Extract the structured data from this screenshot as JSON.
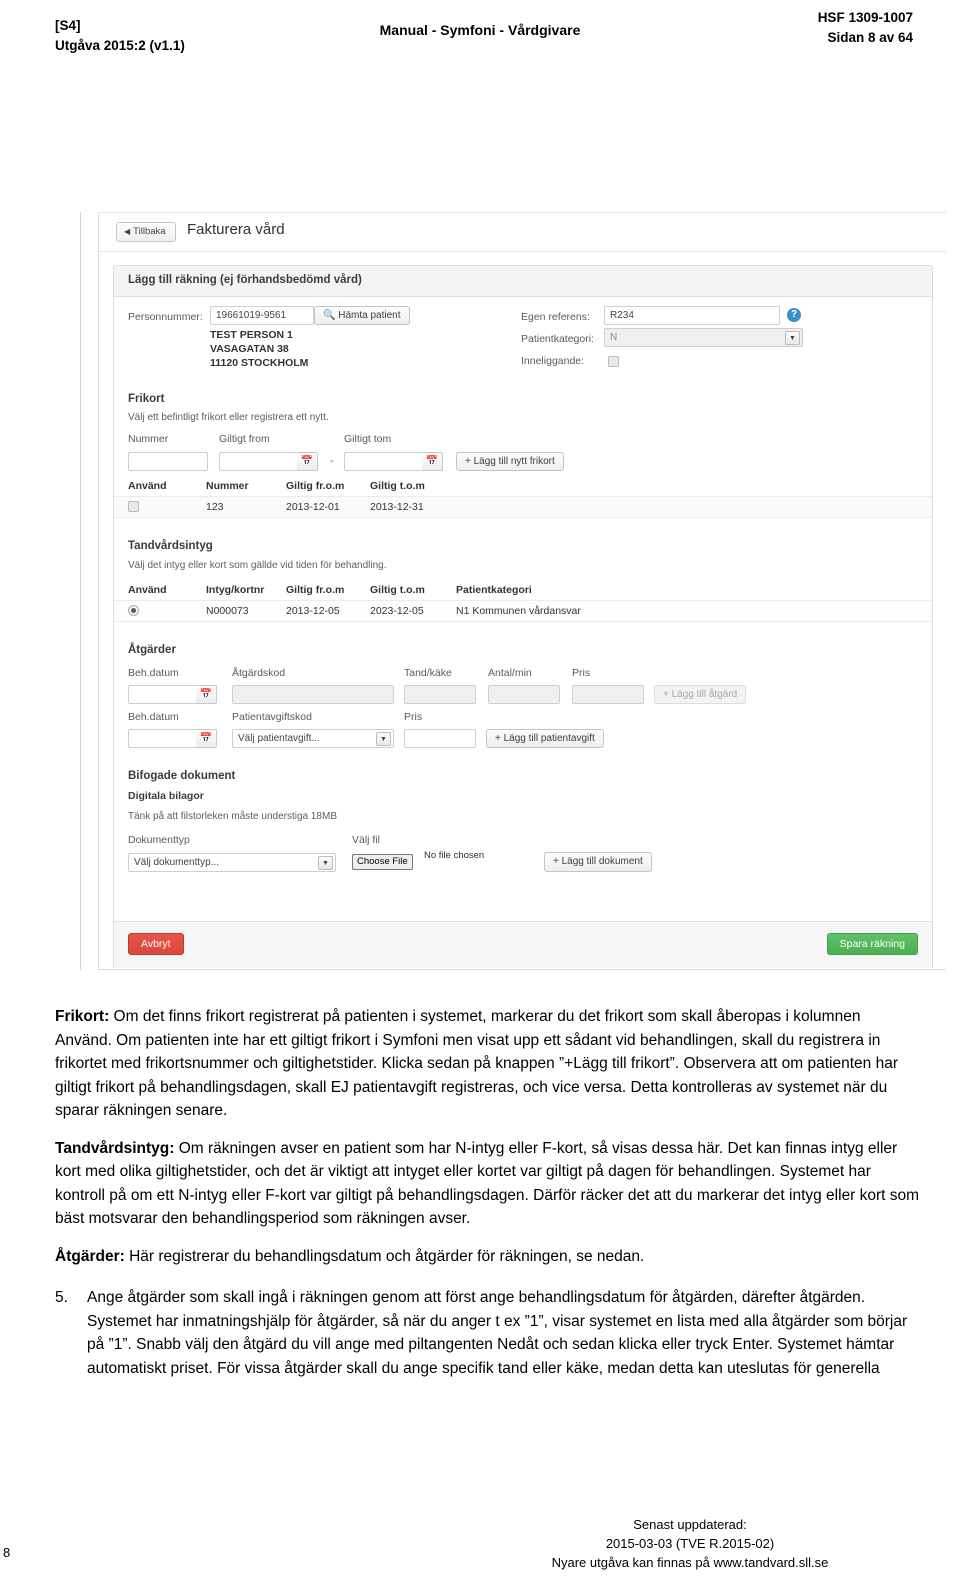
{
  "header": {
    "left_line1": "[S4]",
    "left_line2": "Utgåva 2015:2 (v1.1)",
    "center": "Manual - Symfoni - Vårdgivare",
    "right_line1": "HSF 1309-1007",
    "right_line2": "Sidan 8 av 64"
  },
  "screenshot": {
    "back_button": "Tillbaka",
    "title": "Fakturera vård",
    "panel_title": "Lägg till räkning (ej förhandsbedömd vård)",
    "patient": {
      "personnummer_label": "Personnummer:",
      "personnummer_value": "19661019-9561",
      "fetch_button": "Hämta patient",
      "name": "TEST PERSON 1",
      "street": "VASAGATAN 38",
      "city": "11120 STOCKHOLM"
    },
    "refs": {
      "egen_referens_label": "Egen referens:",
      "egen_referens_value": "R234",
      "help_glyph": "?",
      "patientkategori_label": "Patientkategori:",
      "patientkategori_value": "N",
      "inneliggande_label": "Inneliggande:"
    },
    "frikort": {
      "title": "Frikort",
      "note": "Välj ett befintligt frikort eller registrera ett nytt.",
      "field_labels": [
        "Nummer",
        "Giltigt from",
        "Giltigt tom"
      ],
      "nummer_value": "",
      "from_value": "",
      "tom_value": "",
      "separator": "-",
      "add_button": "+ Lägg till nytt frikort",
      "columns": [
        "Använd",
        "Nummer",
        "Giltig fr.o.m",
        "Giltig t.o.m"
      ],
      "rows": [
        {
          "nummer": "123",
          "from": "2013-12-01",
          "tom": "2013-12-31"
        }
      ]
    },
    "intyg": {
      "title": "Tandvårdsintyg",
      "note": "Välj det intyg eller kort som gällde vid tiden för behandling.",
      "columns": [
        "Använd",
        "Intyg/kortnr",
        "Giltig fr.o.m",
        "Giltig t.o.m",
        "Patientkategori"
      ],
      "rows": [
        {
          "nr": "N000073",
          "from": "2013-12-05",
          "tom": "2023-12-05",
          "kategori": "N1 Kommunen vårdansvar"
        }
      ]
    },
    "atgarder": {
      "title": "Åtgärder",
      "row1_labels": [
        "Beh.datum",
        "Åtgärdskod",
        "Tand/käke",
        "Antal/min",
        "Pris"
      ],
      "row1_add_button": "+ Lägg till åtgärd",
      "row2_labels": [
        "Beh.datum",
        "Patientavgiftskod",
        "Pris"
      ],
      "row2_select_value": "Välj patientavgift...",
      "row2_add_button": "+ Lägg till patientavgift"
    },
    "dokument": {
      "title": "Bifogade dokument",
      "subtitle": "Digitala bilagor",
      "note": "Tänk på att filstorleken måste understiga 18MB",
      "type_label": "Dokumenttyp",
      "type_value": "Välj dokumenttyp...",
      "file_label": "Välj fil",
      "file_button": "Choose File",
      "file_status": "No file chosen",
      "add_button": "+ Lägg till dokument"
    },
    "footer": {
      "cancel_button": "Avbryt",
      "save_button": "Spara räkning"
    }
  },
  "body": {
    "p1_lead": "Frikort:",
    "p1_text": " Om det finns frikort registrerat på patienten i systemet, markerar du det frikort som skall åberopas i kolumnen Använd. Om patienten inte har ett giltigt frikort i Symfoni men visat upp ett sådant vid behandlingen, skall du registrera in frikortet med frikortsnummer och giltighetstider. Klicka sedan på knappen ”+Lägg till frikort”. Observera att om patienten har giltigt frikort på behandlingsdagen, skall EJ patientavgift registreras, och vice versa. Detta kontrolleras av systemet när du sparar räkningen senare.",
    "p2_lead": "Tandvårdsintyg:",
    "p2_text": " Om räkningen avser en patient som har N-intyg eller F-kort, så visas dessa här. Det kan finnas intyg eller kort med olika giltighetstider, och det är viktigt att intyget eller kortet var giltigt på dagen för behandlingen. Systemet har kontroll på om ett N-intyg eller F-kort var giltigt på behandlingsdagen. Därför räcker det att du markerar det intyg eller kort som bäst motsvarar den behandlingsperiod som räkningen avser.",
    "p3_lead": "Åtgärder:",
    "p3_text": " Här registrerar du behandlingsdatum och åtgärder för räkningen, se nedan.",
    "item5_num": "5.",
    "item5_text": "Ange åtgärder som skall ingå i räkningen genom att först ange behandlingsdatum för åtgärden, därefter åtgärden. Systemet har inmatningshjälp för åtgärder, så när du anger t ex ”1”, visar systemet en lista med alla åtgärder som börjar på ”1”. Snabb välj den åtgärd du vill ange med piltangenten Nedåt och sedan klicka eller tryck Enter. Systemet hämtar automatiskt priset. För vissa åtgärder skall du ange specifik tand eller käke, medan detta kan uteslutas för generella"
  },
  "page_footer": {
    "page_number": "8",
    "line1": "Senast uppdaterad:",
    "line2": "2015-03-03 (TVE R.2015-02)",
    "line3": "Nyare utgåva kan finnas på www.tandvard.sll.se"
  }
}
